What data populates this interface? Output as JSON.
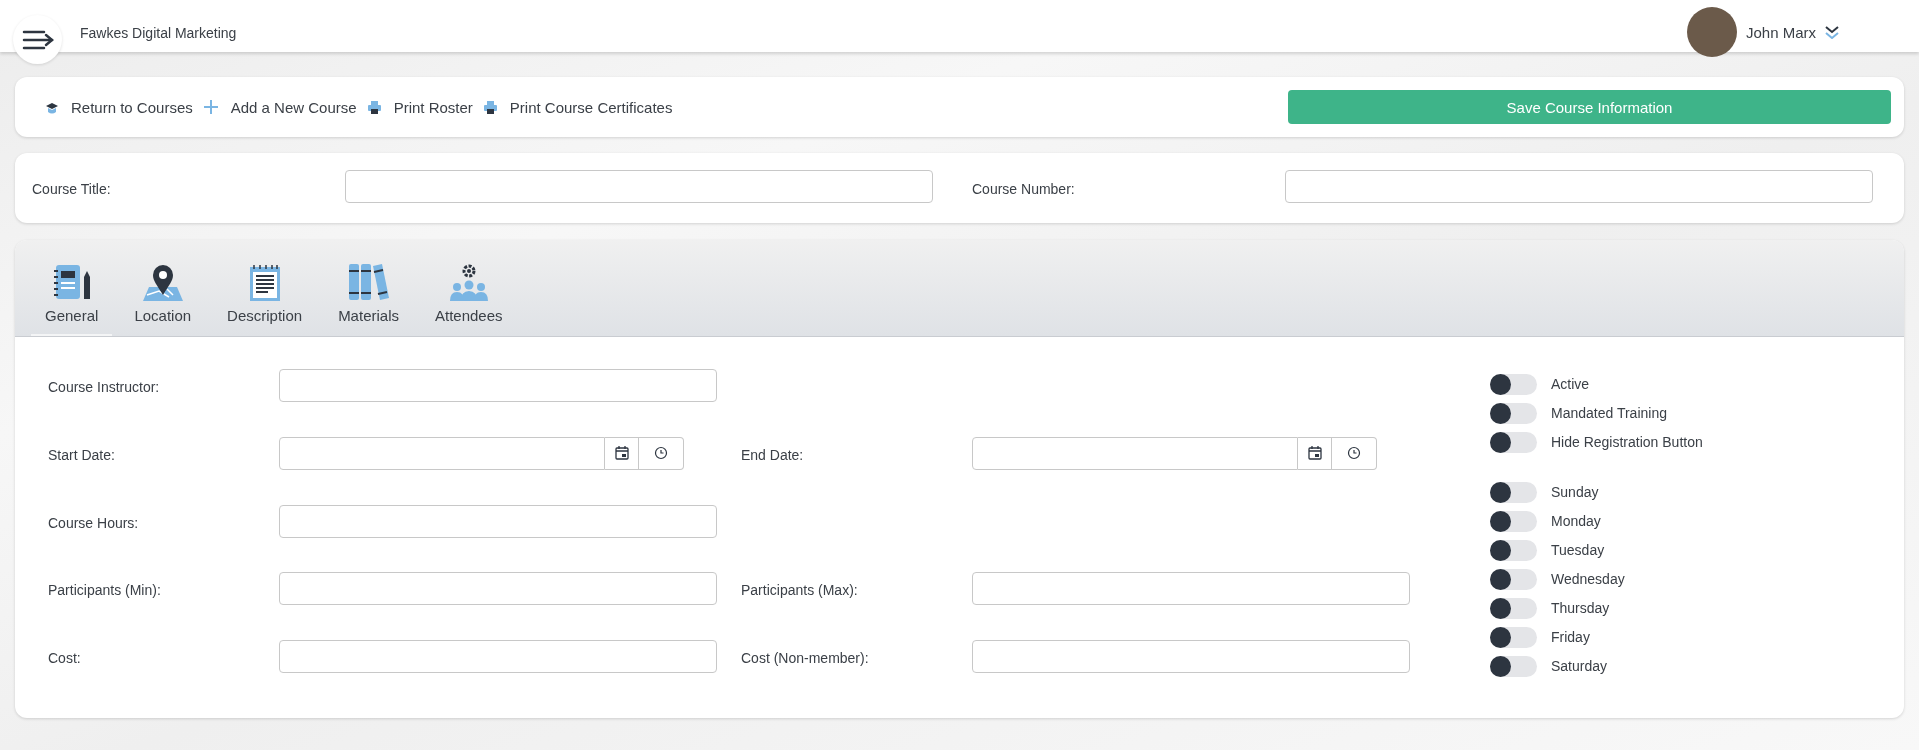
{
  "header": {
    "company": "Fawkes Digital Marketing",
    "user": {
      "name": "John Marx"
    }
  },
  "toolbar": {
    "links": [
      {
        "label": "Return to Courses",
        "kind": "cap"
      },
      {
        "label": "Add a New Course",
        "kind": "plus"
      },
      {
        "label": "Print Roster",
        "kind": "printer"
      },
      {
        "label": "Print Course Certificates",
        "kind": "printer"
      }
    ],
    "save_button": "Save Course Information"
  },
  "course": {
    "fields": [
      {
        "label": "Course Title:"
      },
      {
        "label": "Course Number:"
      }
    ]
  },
  "tabs": [
    {
      "label": "General",
      "kind": "notebook",
      "selected": true
    },
    {
      "label": "Location",
      "kind": "map",
      "selected": false
    },
    {
      "label": "Description",
      "kind": "document",
      "selected": false
    },
    {
      "label": "Materials",
      "kind": "books",
      "selected": false
    },
    {
      "label": "Attendees",
      "kind": "people",
      "selected": false
    }
  ],
  "form": {
    "rows": [
      {
        "cells": [
          {
            "label": "Course Instructor:",
            "kind": "text"
          }
        ]
      },
      {
        "cells": [
          {
            "label": "Start Date:",
            "kind": "datetime"
          },
          {
            "label": "End Date:",
            "kind": "datetime"
          }
        ]
      },
      {
        "cells": [
          {
            "label": "Course Hours:",
            "kind": "text"
          }
        ]
      },
      {
        "cells": [
          {
            "label": "Participants (Min):",
            "kind": "text"
          },
          {
            "label": "Participants (Max):",
            "kind": "text"
          }
        ]
      },
      {
        "cells": [
          {
            "label": "Cost:",
            "kind": "text"
          },
          {
            "label": "Cost (Non-member):",
            "kind": "text"
          }
        ]
      }
    ]
  },
  "options": [
    {
      "label": "Active",
      "on": false
    },
    {
      "label": "Mandated Training",
      "on": false
    },
    {
      "label": "Hide Registration Button",
      "on": false
    }
  ],
  "days": [
    {
      "label": "Sunday",
      "on": false
    },
    {
      "label": "Monday",
      "on": false
    },
    {
      "label": "Tuesday",
      "on": false
    },
    {
      "label": "Wednesday",
      "on": false
    },
    {
      "label": "Thursday",
      "on": false
    },
    {
      "label": "Friday",
      "on": false
    },
    {
      "label": "Saturday",
      "on": false
    }
  ]
}
